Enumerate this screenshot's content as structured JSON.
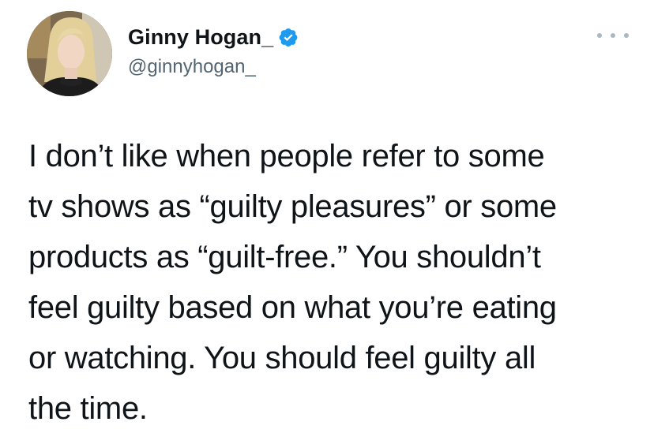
{
  "author": {
    "display_name": "Ginny Hogan_",
    "handle": "@ginnyhogan_",
    "verified_badge_icon": "verified-check-icon",
    "verified_color": "#1d9bf0"
  },
  "menu": {
    "icon": "more-dots-icon"
  },
  "tweet": {
    "lines": [
      "I don’t like when people refer to some",
      "tv shows as “guilty pleasures” or some",
      "products as “guilt-free.” You shouldn’t",
      "feel guilty based on what you’re eating",
      "or watching. You should feel guilty all",
      "the time."
    ]
  }
}
